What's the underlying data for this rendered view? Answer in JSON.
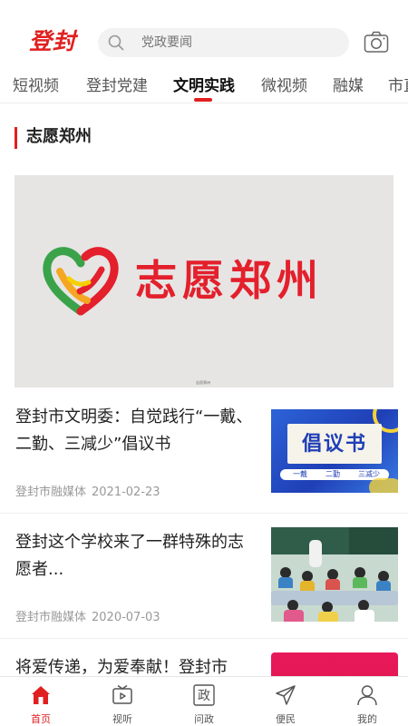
{
  "header": {
    "logo_text": "登封",
    "search_placeholder": "党政要闻",
    "search_icon": "search-icon",
    "camera_icon": "camera-icon",
    "accent_color": "#e02020"
  },
  "tabs": [
    {
      "label": "短视频",
      "active": false
    },
    {
      "label": "登封党建",
      "active": false
    },
    {
      "label": "文明实践",
      "active": true
    },
    {
      "label": "微视频",
      "active": false
    },
    {
      "label": "融媒",
      "active": false
    },
    {
      "label": "市直",
      "active": false
    }
  ],
  "section": {
    "title": "志愿郑州"
  },
  "banner": {
    "text": "志愿郑州",
    "caption": "志愿郑州"
  },
  "news": [
    {
      "title": "登封市文明委：自觉践行“一戴、二勤、三减少”倡议书",
      "source": "登封市融媒体",
      "date": "2021-02-23",
      "thumb_text": "倡议书",
      "thumb_sub": [
        "一戴",
        "二勤",
        "三减少"
      ]
    },
    {
      "title": "登封这个学校来了一群特殊的志愿者...",
      "source": "登封市融媒体",
      "date": "2020-07-03"
    },
    {
      "title": "将爱传递，为爱奉献！登封市"
    }
  ],
  "bottom_nav": [
    {
      "label": "首页",
      "icon": "home-icon",
      "active": true
    },
    {
      "label": "视听",
      "icon": "tv-icon",
      "active": false
    },
    {
      "label": "问政",
      "icon": "politics-icon",
      "icon_text": "政",
      "active": false
    },
    {
      "label": "便民",
      "icon": "send-icon",
      "active": false
    },
    {
      "label": "我的",
      "icon": "user-icon",
      "active": false
    }
  ]
}
